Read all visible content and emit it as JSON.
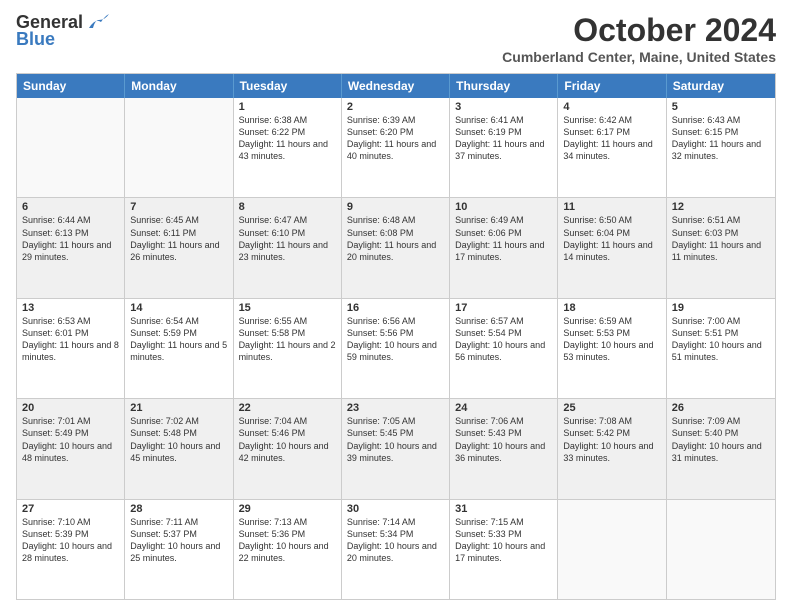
{
  "logo": {
    "general": "General",
    "blue": "Blue"
  },
  "title": "October 2024",
  "location": "Cumberland Center, Maine, United States",
  "days": [
    "Sunday",
    "Monday",
    "Tuesday",
    "Wednesday",
    "Thursday",
    "Friday",
    "Saturday"
  ],
  "weeks": [
    [
      {
        "day": "",
        "empty": true
      },
      {
        "day": "",
        "empty": true
      },
      {
        "day": "1",
        "sunrise": "Sunrise: 6:38 AM",
        "sunset": "Sunset: 6:22 PM",
        "daylight": "Daylight: 11 hours and 43 minutes."
      },
      {
        "day": "2",
        "sunrise": "Sunrise: 6:39 AM",
        "sunset": "Sunset: 6:20 PM",
        "daylight": "Daylight: 11 hours and 40 minutes."
      },
      {
        "day": "3",
        "sunrise": "Sunrise: 6:41 AM",
        "sunset": "Sunset: 6:19 PM",
        "daylight": "Daylight: 11 hours and 37 minutes."
      },
      {
        "day": "4",
        "sunrise": "Sunrise: 6:42 AM",
        "sunset": "Sunset: 6:17 PM",
        "daylight": "Daylight: 11 hours and 34 minutes."
      },
      {
        "day": "5",
        "sunrise": "Sunrise: 6:43 AM",
        "sunset": "Sunset: 6:15 PM",
        "daylight": "Daylight: 11 hours and 32 minutes."
      }
    ],
    [
      {
        "day": "6",
        "sunrise": "Sunrise: 6:44 AM",
        "sunset": "Sunset: 6:13 PM",
        "daylight": "Daylight: 11 hours and 29 minutes."
      },
      {
        "day": "7",
        "sunrise": "Sunrise: 6:45 AM",
        "sunset": "Sunset: 6:11 PM",
        "daylight": "Daylight: 11 hours and 26 minutes."
      },
      {
        "day": "8",
        "sunrise": "Sunrise: 6:47 AM",
        "sunset": "Sunset: 6:10 PM",
        "daylight": "Daylight: 11 hours and 23 minutes."
      },
      {
        "day": "9",
        "sunrise": "Sunrise: 6:48 AM",
        "sunset": "Sunset: 6:08 PM",
        "daylight": "Daylight: 11 hours and 20 minutes."
      },
      {
        "day": "10",
        "sunrise": "Sunrise: 6:49 AM",
        "sunset": "Sunset: 6:06 PM",
        "daylight": "Daylight: 11 hours and 17 minutes."
      },
      {
        "day": "11",
        "sunrise": "Sunrise: 6:50 AM",
        "sunset": "Sunset: 6:04 PM",
        "daylight": "Daylight: 11 hours and 14 minutes."
      },
      {
        "day": "12",
        "sunrise": "Sunrise: 6:51 AM",
        "sunset": "Sunset: 6:03 PM",
        "daylight": "Daylight: 11 hours and 11 minutes."
      }
    ],
    [
      {
        "day": "13",
        "sunrise": "Sunrise: 6:53 AM",
        "sunset": "Sunset: 6:01 PM",
        "daylight": "Daylight: 11 hours and 8 minutes."
      },
      {
        "day": "14",
        "sunrise": "Sunrise: 6:54 AM",
        "sunset": "Sunset: 5:59 PM",
        "daylight": "Daylight: 11 hours and 5 minutes."
      },
      {
        "day": "15",
        "sunrise": "Sunrise: 6:55 AM",
        "sunset": "Sunset: 5:58 PM",
        "daylight": "Daylight: 11 hours and 2 minutes."
      },
      {
        "day": "16",
        "sunrise": "Sunrise: 6:56 AM",
        "sunset": "Sunset: 5:56 PM",
        "daylight": "Daylight: 10 hours and 59 minutes."
      },
      {
        "day": "17",
        "sunrise": "Sunrise: 6:57 AM",
        "sunset": "Sunset: 5:54 PM",
        "daylight": "Daylight: 10 hours and 56 minutes."
      },
      {
        "day": "18",
        "sunrise": "Sunrise: 6:59 AM",
        "sunset": "Sunset: 5:53 PM",
        "daylight": "Daylight: 10 hours and 53 minutes."
      },
      {
        "day": "19",
        "sunrise": "Sunrise: 7:00 AM",
        "sunset": "Sunset: 5:51 PM",
        "daylight": "Daylight: 10 hours and 51 minutes."
      }
    ],
    [
      {
        "day": "20",
        "sunrise": "Sunrise: 7:01 AM",
        "sunset": "Sunset: 5:49 PM",
        "daylight": "Daylight: 10 hours and 48 minutes."
      },
      {
        "day": "21",
        "sunrise": "Sunrise: 7:02 AM",
        "sunset": "Sunset: 5:48 PM",
        "daylight": "Daylight: 10 hours and 45 minutes."
      },
      {
        "day": "22",
        "sunrise": "Sunrise: 7:04 AM",
        "sunset": "Sunset: 5:46 PM",
        "daylight": "Daylight: 10 hours and 42 minutes."
      },
      {
        "day": "23",
        "sunrise": "Sunrise: 7:05 AM",
        "sunset": "Sunset: 5:45 PM",
        "daylight": "Daylight: 10 hours and 39 minutes."
      },
      {
        "day": "24",
        "sunrise": "Sunrise: 7:06 AM",
        "sunset": "Sunset: 5:43 PM",
        "daylight": "Daylight: 10 hours and 36 minutes."
      },
      {
        "day": "25",
        "sunrise": "Sunrise: 7:08 AM",
        "sunset": "Sunset: 5:42 PM",
        "daylight": "Daylight: 10 hours and 33 minutes."
      },
      {
        "day": "26",
        "sunrise": "Sunrise: 7:09 AM",
        "sunset": "Sunset: 5:40 PM",
        "daylight": "Daylight: 10 hours and 31 minutes."
      }
    ],
    [
      {
        "day": "27",
        "sunrise": "Sunrise: 7:10 AM",
        "sunset": "Sunset: 5:39 PM",
        "daylight": "Daylight: 10 hours and 28 minutes."
      },
      {
        "day": "28",
        "sunrise": "Sunrise: 7:11 AM",
        "sunset": "Sunset: 5:37 PM",
        "daylight": "Daylight: 10 hours and 25 minutes."
      },
      {
        "day": "29",
        "sunrise": "Sunrise: 7:13 AM",
        "sunset": "Sunset: 5:36 PM",
        "daylight": "Daylight: 10 hours and 22 minutes."
      },
      {
        "day": "30",
        "sunrise": "Sunrise: 7:14 AM",
        "sunset": "Sunset: 5:34 PM",
        "daylight": "Daylight: 10 hours and 20 minutes."
      },
      {
        "day": "31",
        "sunrise": "Sunrise: 7:15 AM",
        "sunset": "Sunset: 5:33 PM",
        "daylight": "Daylight: 10 hours and 17 minutes."
      },
      {
        "day": "",
        "empty": true
      },
      {
        "day": "",
        "empty": true
      }
    ]
  ]
}
